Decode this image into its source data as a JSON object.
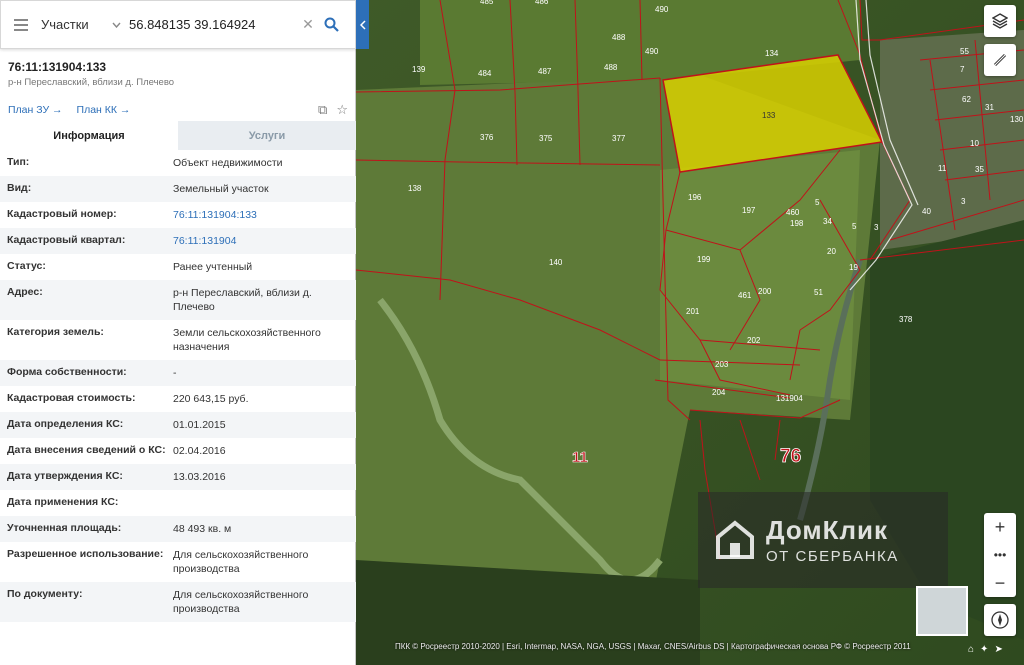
{
  "search": {
    "type_label": "Участки",
    "query": "56.848135 39.164924"
  },
  "object": {
    "cadastral_number": "76:11:131904:133",
    "subtitle": "р-н Переславский, вблизи д. Плечево"
  },
  "links": {
    "plan_zu": "План ЗУ →",
    "plan_kk": "План КК →"
  },
  "tabs": [
    {
      "label": "Информация"
    },
    {
      "label": "Услуги"
    }
  ],
  "properties": [
    {
      "key": "Тип:",
      "value": "Объект недвижимости"
    },
    {
      "key": "Вид:",
      "value": "Земельный участок"
    },
    {
      "key": "Кадастровый номер:",
      "value": "76:11:131904:133"
    },
    {
      "key": "Кадастровый квартал:",
      "value": "76:11:131904"
    },
    {
      "key": "Статус:",
      "value": "Ранее учтенный"
    },
    {
      "key": "Адрес:",
      "value": "р-н Переславский, вблизи д. Плечево"
    },
    {
      "key": "Категория земель:",
      "value": "Земли сельскохозяйственного назначения"
    },
    {
      "key": "Форма собственности:",
      "value": "-"
    },
    {
      "key": "Кадастровая стоимость:",
      "value": "220 643,15 руб."
    },
    {
      "key": "Дата определения КС:",
      "value": "01.01.2015"
    },
    {
      "key": "Дата внесения сведений о КС:",
      "value": "02.04.2016"
    },
    {
      "key": "Дата утверждения КС:",
      "value": "13.03.2016"
    },
    {
      "key": "Дата применения КС:",
      "value": ""
    },
    {
      "key": "Уточненная площадь:",
      "value": "48 493 кв. м"
    },
    {
      "key": "Разрешенное использование:",
      "value": "Для сельскохозяйственного производства"
    },
    {
      "key": "По документу:",
      "value": "Для сельскохозяйственного производства"
    }
  ],
  "map": {
    "plot_labels": [
      "485",
      "486",
      "490",
      "488",
      "490",
      "139",
      "484",
      "487",
      "488",
      "134",
      "133",
      "376",
      "375",
      "377",
      "138",
      "196",
      "197",
      "460",
      "198",
      "140",
      "199",
      "461",
      "200",
      "201",
      "202",
      "203",
      "204",
      "131904",
      "11",
      "76",
      "378",
      "55",
      "7",
      "62",
      "31",
      "10",
      "11",
      "35",
      "40",
      "3",
      "130",
      "5",
      "34",
      "5",
      "3",
      "20",
      "19",
      "51",
      "130"
    ],
    "quarter_label": "131904",
    "district_label": "76",
    "zone_label": "11"
  },
  "watermark": {
    "line1": "ДомКлик",
    "line2": "ОТ СБЕРБАНКА"
  },
  "attribution": "ПКК © Росреестр 2010-2020 | Esri, Intermap, NASA, NGA, USGS | Maxar, CNES/Airbus DS | Картографическая основа РФ © Росреестр 2011",
  "colors": {
    "highlight": "#d8d000",
    "boundary": "#c0121a",
    "accent": "#2d6fb8"
  }
}
